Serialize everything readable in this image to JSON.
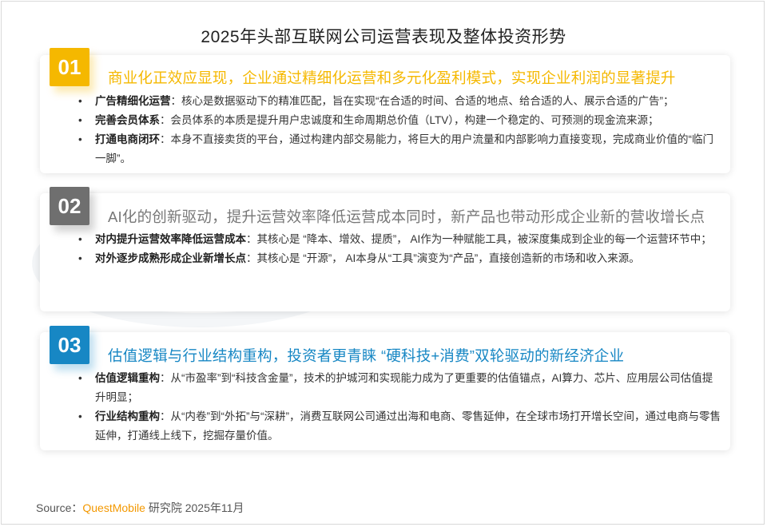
{
  "title": "2025年头部互联网公司运营表现及整体投资形势",
  "sections": [
    {
      "number": "01",
      "heading": "商业化正效应显现，企业通过精细化运营和多元化盈利模式，实现企业利润的显著提升",
      "bullets": [
        {
          "term": "广告精细化运营",
          "text": "：核心是数据驱动下的精准匹配，旨在实现“在合适的时间、合适的地点、给合适的人、展示合适的广告”；"
        },
        {
          "term": "完善会员体系",
          "text": "：会员体系的本质是提升用户忠诚度和生命周期总价值（LTV），构建一个稳定的、可预测的现金流来源；"
        },
        {
          "term": "打通电商闭环",
          "text": "：本身不直接卖货的平台，通过构建内部交易能力，将巨大的用户流量和内部影响力直接变现，完成商业价值的“临门一脚”。"
        }
      ]
    },
    {
      "number": "02",
      "heading": "AI化的创新驱动，提升运营效率降低运营成本同时，新产品也带动形成企业新的营收增长点",
      "bullets": [
        {
          "term": "对内提升运营效率降低运营成本",
          "text": "：其核心是 “降本、增效、提质”， AI作为一种赋能工具，被深度集成到企业的每一个运营环节中；"
        },
        {
          "term": "对外逐步成熟形成企业新增长点",
          "text": "：其核心是 “开源”， AI本身从“工具”演变为“产品”，直接创造新的市场和收入来源。"
        }
      ]
    },
    {
      "number": "03",
      "heading": "估值逻辑与行业结构重构，投资者更青睐 “硬科技+消费”双轮驱动的新经济企业",
      "bullets": [
        {
          "term": "估值逻辑重构",
          "text": "：从“市盈率”到“科技含金量”，技术的护城河和实现能力成为了更重要的估值锚点，AI算力、芯片、应用层公司估值提升明显；"
        },
        {
          "term": "行业结构重构",
          "text": "：从“内卷”到“外拓”与“深耕”，消费互联网公司通过出海和电商、零售延伸，在全球市场打开增长空间，通过电商与零售延伸，打通线上线下，挖掘存量价值。"
        }
      ]
    }
  ],
  "bullet_symbol": "•",
  "source": {
    "prefix": "Source：",
    "brand": "QuestMobile",
    "suffix": " 研究院 2025年11月"
  },
  "colors": {
    "section1": "#f5b800",
    "section2": "#6f6f6f",
    "section3": "#1787c4",
    "brand": "#f39800"
  }
}
